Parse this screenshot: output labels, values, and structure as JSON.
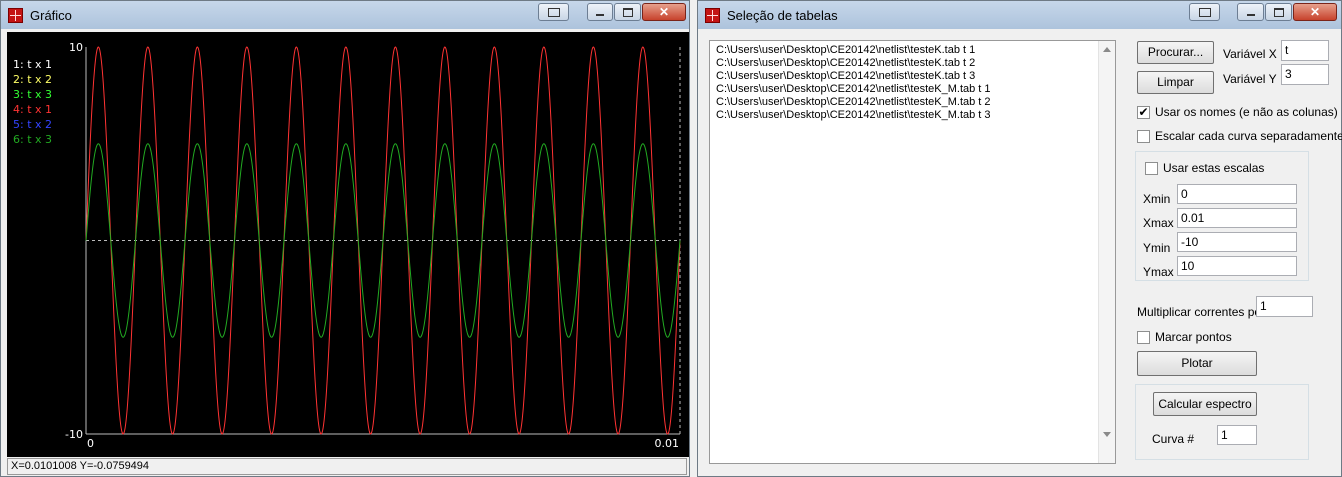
{
  "grafico_window": {
    "title": "Gráfico",
    "status": "X=0.0101008 Y=-0.0759494",
    "legend": [
      {
        "label": "1: t x 1",
        "color": "#ffffff"
      },
      {
        "label": "2: t x 2",
        "color": "#ffff66"
      },
      {
        "label": "3: t x 3",
        "color": "#33ff33"
      },
      {
        "label": "4: t x 1",
        "color": "#ff3333"
      },
      {
        "label": "5: t x 2",
        "color": "#3344ff"
      },
      {
        "label": "6: t x 3",
        "color": "#22aa22"
      }
    ]
  },
  "chart_data": {
    "type": "line",
    "xlim": [
      0,
      0.01
    ],
    "ylim": [
      -10,
      10
    ],
    "x_tick_labels": [
      "0",
      "0.01"
    ],
    "y_tick_labels": [
      "10",
      "-10"
    ],
    "grid": false,
    "zero_line": true,
    "legend_placement": "top-left",
    "series": [
      {
        "name": "4: t x 1",
        "color": "#ff3333",
        "amplitude": 10,
        "cycles": 12,
        "phase": 0
      },
      {
        "name": "6: t x 3",
        "color": "#22aa22",
        "amplitude": 5,
        "cycles": 12,
        "phase": 0
      }
    ]
  },
  "selecao_window": {
    "title": "Seleção de tabelas",
    "files": [
      "C:\\Users\\user\\Desktop\\CE20142\\netlist\\testeK.tab t 1",
      "C:\\Users\\user\\Desktop\\CE20142\\netlist\\testeK.tab t 2",
      "C:\\Users\\user\\Desktop\\CE20142\\netlist\\testeK.tab t 3",
      "C:\\Users\\user\\Desktop\\CE20142\\netlist\\testeK_M.tab t 1",
      "C:\\Users\\user\\Desktop\\CE20142\\netlist\\testeK_M.tab t 2",
      "C:\\Users\\user\\Desktop\\CE20142\\netlist\\testeK_M.tab t 3"
    ],
    "procurar_label": "Procurar...",
    "limpar_label": "Limpar",
    "varx_label": "Variável X",
    "varx_value": "t",
    "vary_label": "Variável Y",
    "vary_value": "3",
    "usar_nomes_label": "Usar os nomes (e não as colunas)",
    "usar_nomes_checked": true,
    "escalar_label": "Escalar cada curva separadamente",
    "escalar_checked": false,
    "usar_escalas_label": "Usar estas escalas",
    "usar_escalas_checked": false,
    "xmin_label": "Xmin",
    "xmin_value": "0",
    "xmax_label": "Xmax",
    "xmax_value": "0.01",
    "ymin_label": "Ymin",
    "ymin_value": "-10",
    "ymax_label": "Ymax",
    "ymax_value": "10",
    "multiplicar_label": "Multiplicar correntes por",
    "multiplicar_value": "1",
    "marcar_label": "Marcar pontos",
    "marcar_checked": false,
    "plotar_label": "Plotar",
    "calcular_label": "Calcular espectro",
    "curva_label": "Curva #",
    "curva_value": "1"
  },
  "check_glyph": "✔",
  "close_glyph": "✕"
}
